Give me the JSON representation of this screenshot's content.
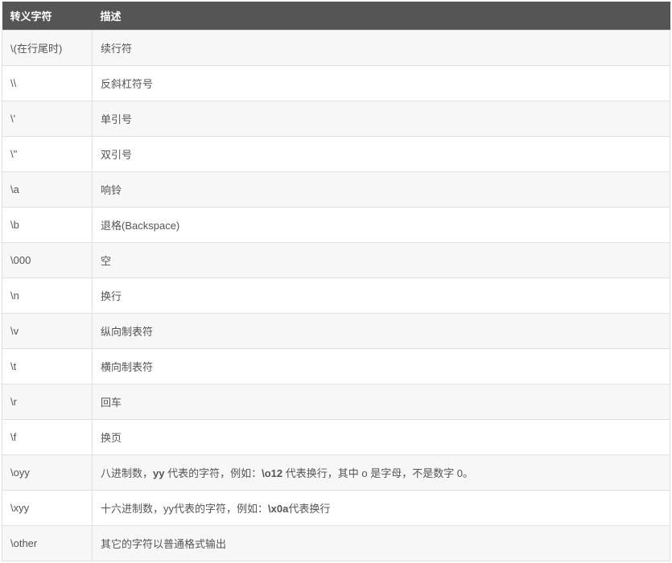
{
  "table": {
    "columns": [
      "转义字符",
      "描述"
    ],
    "rows": [
      {
        "c0": "\\(在行尾时)",
        "c1": "续行符"
      },
      {
        "c0": "\\\\",
        "c1": "反斜杠符号"
      },
      {
        "c0": "\\'",
        "c1": "单引号"
      },
      {
        "c0": "\\\"",
        "c1": "双引号"
      },
      {
        "c0": "\\a",
        "c1": "响铃"
      },
      {
        "c0": "\\b",
        "c1": "退格(Backspace)"
      },
      {
        "c0": "\\000",
        "c1": "空"
      },
      {
        "c0": "\\n",
        "c1": "换行"
      },
      {
        "c0": "\\v",
        "c1": "纵向制表符"
      },
      {
        "c0": "\\t",
        "c1": "横向制表符"
      },
      {
        "c0": "\\r",
        "c1": "回车"
      },
      {
        "c0": "\\f",
        "c1": "换页"
      },
      {
        "c0": "\\oyy",
        "c1_pre": "八进制数，",
        "c1_b1": "yy",
        "c1_mid1": " 代表的字符，例如：",
        "c1_b2": "\\o12",
        "c1_mid2": " 代表换行，其中 o 是字母，不是数字 0。"
      },
      {
        "c0": "\\xyy",
        "c1_pre": "十六进制数，yy代表的字符，例如：",
        "c1_b1": "\\x0a",
        "c1_mid1": "代表换行"
      },
      {
        "c0": "\\other",
        "c1": "其它的字符以普通格式输出"
      }
    ]
  }
}
